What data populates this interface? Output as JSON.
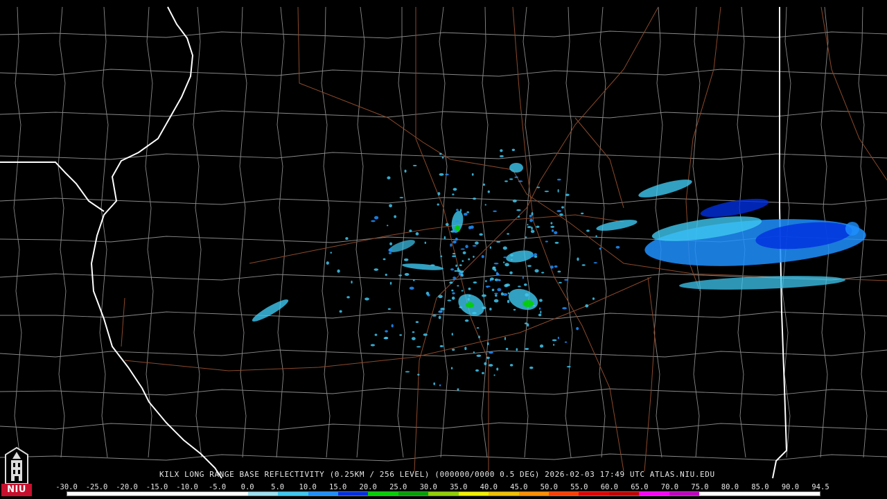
{
  "caption": "KILX LONG RANGE BASE REFLECTIVITY (0.25KM / 256 LEVEL) (000000/0000 0.5 DEG) 2026-02-03 17:49 UTC  ATLAS.NIU.EDU",
  "logo": {
    "text": "NIU",
    "icon": "university-tower-icon"
  },
  "colors": {
    "background": "#000000",
    "county_lines": "#8a8a8a",
    "state_lines": "#ffffff",
    "roads": "#8b4a2b",
    "logo_red": "#c8102e"
  },
  "scale": {
    "labels": [
      "-30.0",
      "-25.0",
      "-20.0",
      "-15.0",
      "-10.0",
      "-5.0",
      "0.0",
      "5.0",
      "10.0",
      "15.0",
      "20.0",
      "25.0",
      "30.0",
      "35.0",
      "40.0",
      "45.0",
      "50.0",
      "55.0",
      "60.0",
      "65.0",
      "70.0",
      "75.0",
      "80.0",
      "85.0",
      "90.0",
      "94.5"
    ],
    "colors": [
      "#ffffff",
      "#ffffff",
      "#ffffff",
      "#ffffff",
      "#ffffff",
      "#ffffff",
      "#9ce0f0",
      "#3ec8f0",
      "#1e90ff",
      "#0030e0",
      "#00d000",
      "#00a000",
      "#90d000",
      "#f0f000",
      "#f0c000",
      "#ff9000",
      "#ff4000",
      "#e00000",
      "#c00000",
      "#ff00ff",
      "#c000c0",
      "#ffffff",
      "#ffffff",
      "#ffffff",
      "#ffffff"
    ]
  }
}
